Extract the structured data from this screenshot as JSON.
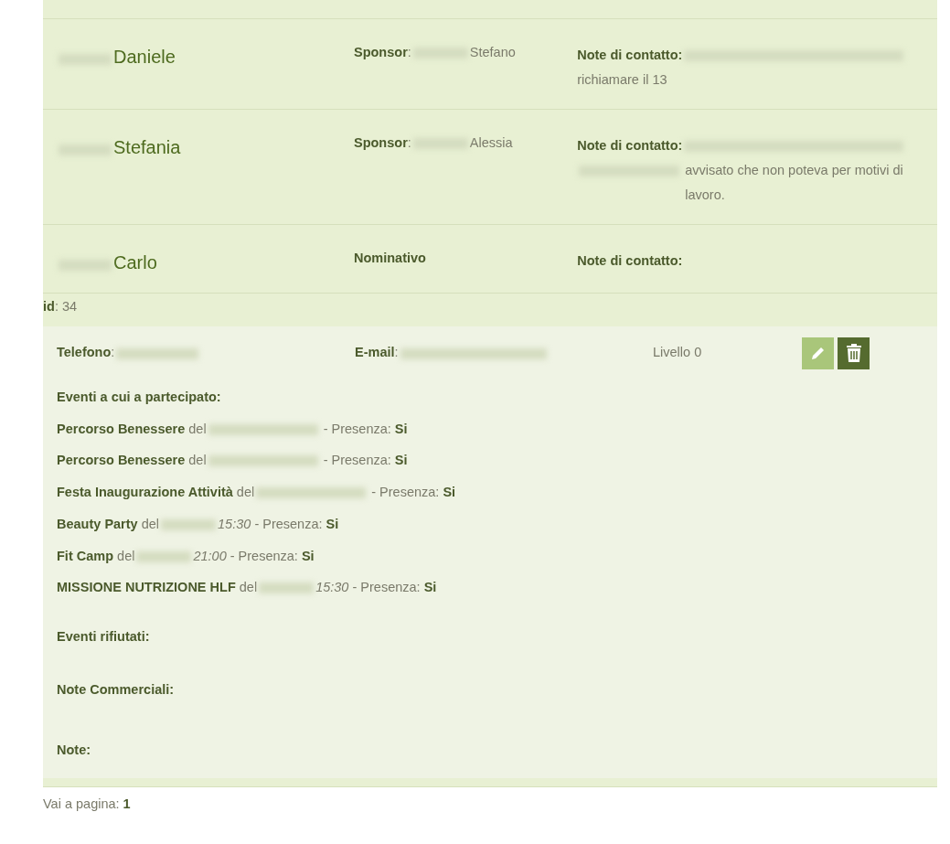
{
  "contacts": [
    {
      "name": "Daniele",
      "surname_hidden": true,
      "middle": {
        "label": "**Sponsor**:",
        "value_hidden": true,
        "value": "Stefano"
      },
      "notes": {
        "label": "Note di contatto:",
        "segments": [
          {
            "kind": "blurline"
          },
          {
            "kind": "text",
            "text": "richiamare il 13"
          }
        ]
      }
    },
    {
      "name": "Stefania",
      "surname_hidden": true,
      "middle": {
        "label": "**Sponsor**:",
        "value_hidden": true,
        "value": "Alessia"
      },
      "notes": {
        "label": "Note di contatto:",
        "segments": [
          {
            "kind": "blurline"
          },
          {
            "kind": "blur"
          },
          {
            "kind": "text",
            "text": "avvisato che non poteva per motivi di lavoro."
          }
        ]
      }
    },
    {
      "name": "Carlo",
      "surname_hidden": true,
      "middle": {
        "label": "**Nominativo**"
      },
      "notes": {
        "label": "Note di contatto:"
      }
    }
  ],
  "detail": {
    "id": "**id**: 34",
    "phone_label": "**Telefono**:",
    "email_label": "**E-mail**:",
    "level": "Livello 0",
    "events_heading": "Eventi a cui a partecipato:",
    "events": [
      {
        "title": "Percorso Benessere",
        "connector": "del",
        "presence": "- Presenza:",
        "answer": "Si"
      },
      {
        "title": "Percorso Benessere",
        "connector": "del",
        "presence": "- Presenza:",
        "answer": "Si"
      },
      {
        "title": "Festa Inaugurazione Attività",
        "connector": "del",
        "presence": "- Presenza:",
        "answer": "Si"
      },
      {
        "title": "Beauty Party",
        "connector": "del",
        "time": "15:30",
        "presence": "- Presenza:",
        "answer": "Si"
      },
      {
        "title": "Fit Camp",
        "connector": "del",
        "time": "21:00",
        "presence": "- Presenza:",
        "answer": "Si"
      },
      {
        "title": "MISSIONE NUTRIZIONE HLF",
        "connector": "del",
        "time": "15:30",
        "presence": "- Presenza:",
        "answer": "Si"
      }
    ],
    "sections": [
      "Eventi rifiutati:",
      "Note Commerciali:",
      "Note:"
    ]
  },
  "pagination": "Vai a pagina: **1**"
}
